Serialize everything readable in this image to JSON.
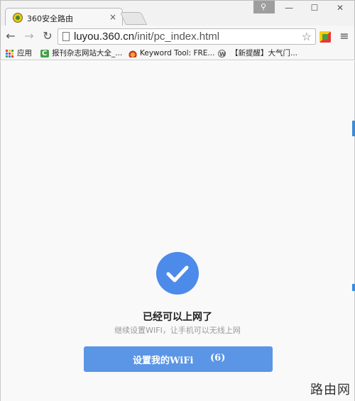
{
  "window": {
    "tab_title": "360安全路由",
    "tab_close": "×",
    "profile_glyph": "⚲",
    "minimize": "—",
    "maximize": "☐",
    "close": "✕"
  },
  "toolbar": {
    "back": "←",
    "forward": "→",
    "reload": "↻",
    "url_host": "luyou.360.cn",
    "url_path": "/init/pc_index.html",
    "bookmark_star": "☆",
    "menu": "≡"
  },
  "bookmarks": [
    {
      "label": "应用",
      "icon": "apps-grid-icon"
    },
    {
      "label": "报刊杂志网站大全_...",
      "icon": "green-c-icon"
    },
    {
      "label": "Keyword Tool: FRE...",
      "icon": "flame-icon"
    },
    {
      "label": "",
      "icon": "wordpress-icon"
    },
    {
      "label": "【新提醒】大气门...",
      "icon": ""
    }
  ],
  "main": {
    "status_title": "已经可以上网了",
    "status_subtitle": "继续设置WIFI，让手机可以无线上网",
    "button_label": "设置我的WiFi",
    "button_countdown": "(6)"
  },
  "watermark": "路由网",
  "colors": {
    "accent": "#4c8bea",
    "button": "#5b95e6",
    "subtitle": "#999999"
  }
}
